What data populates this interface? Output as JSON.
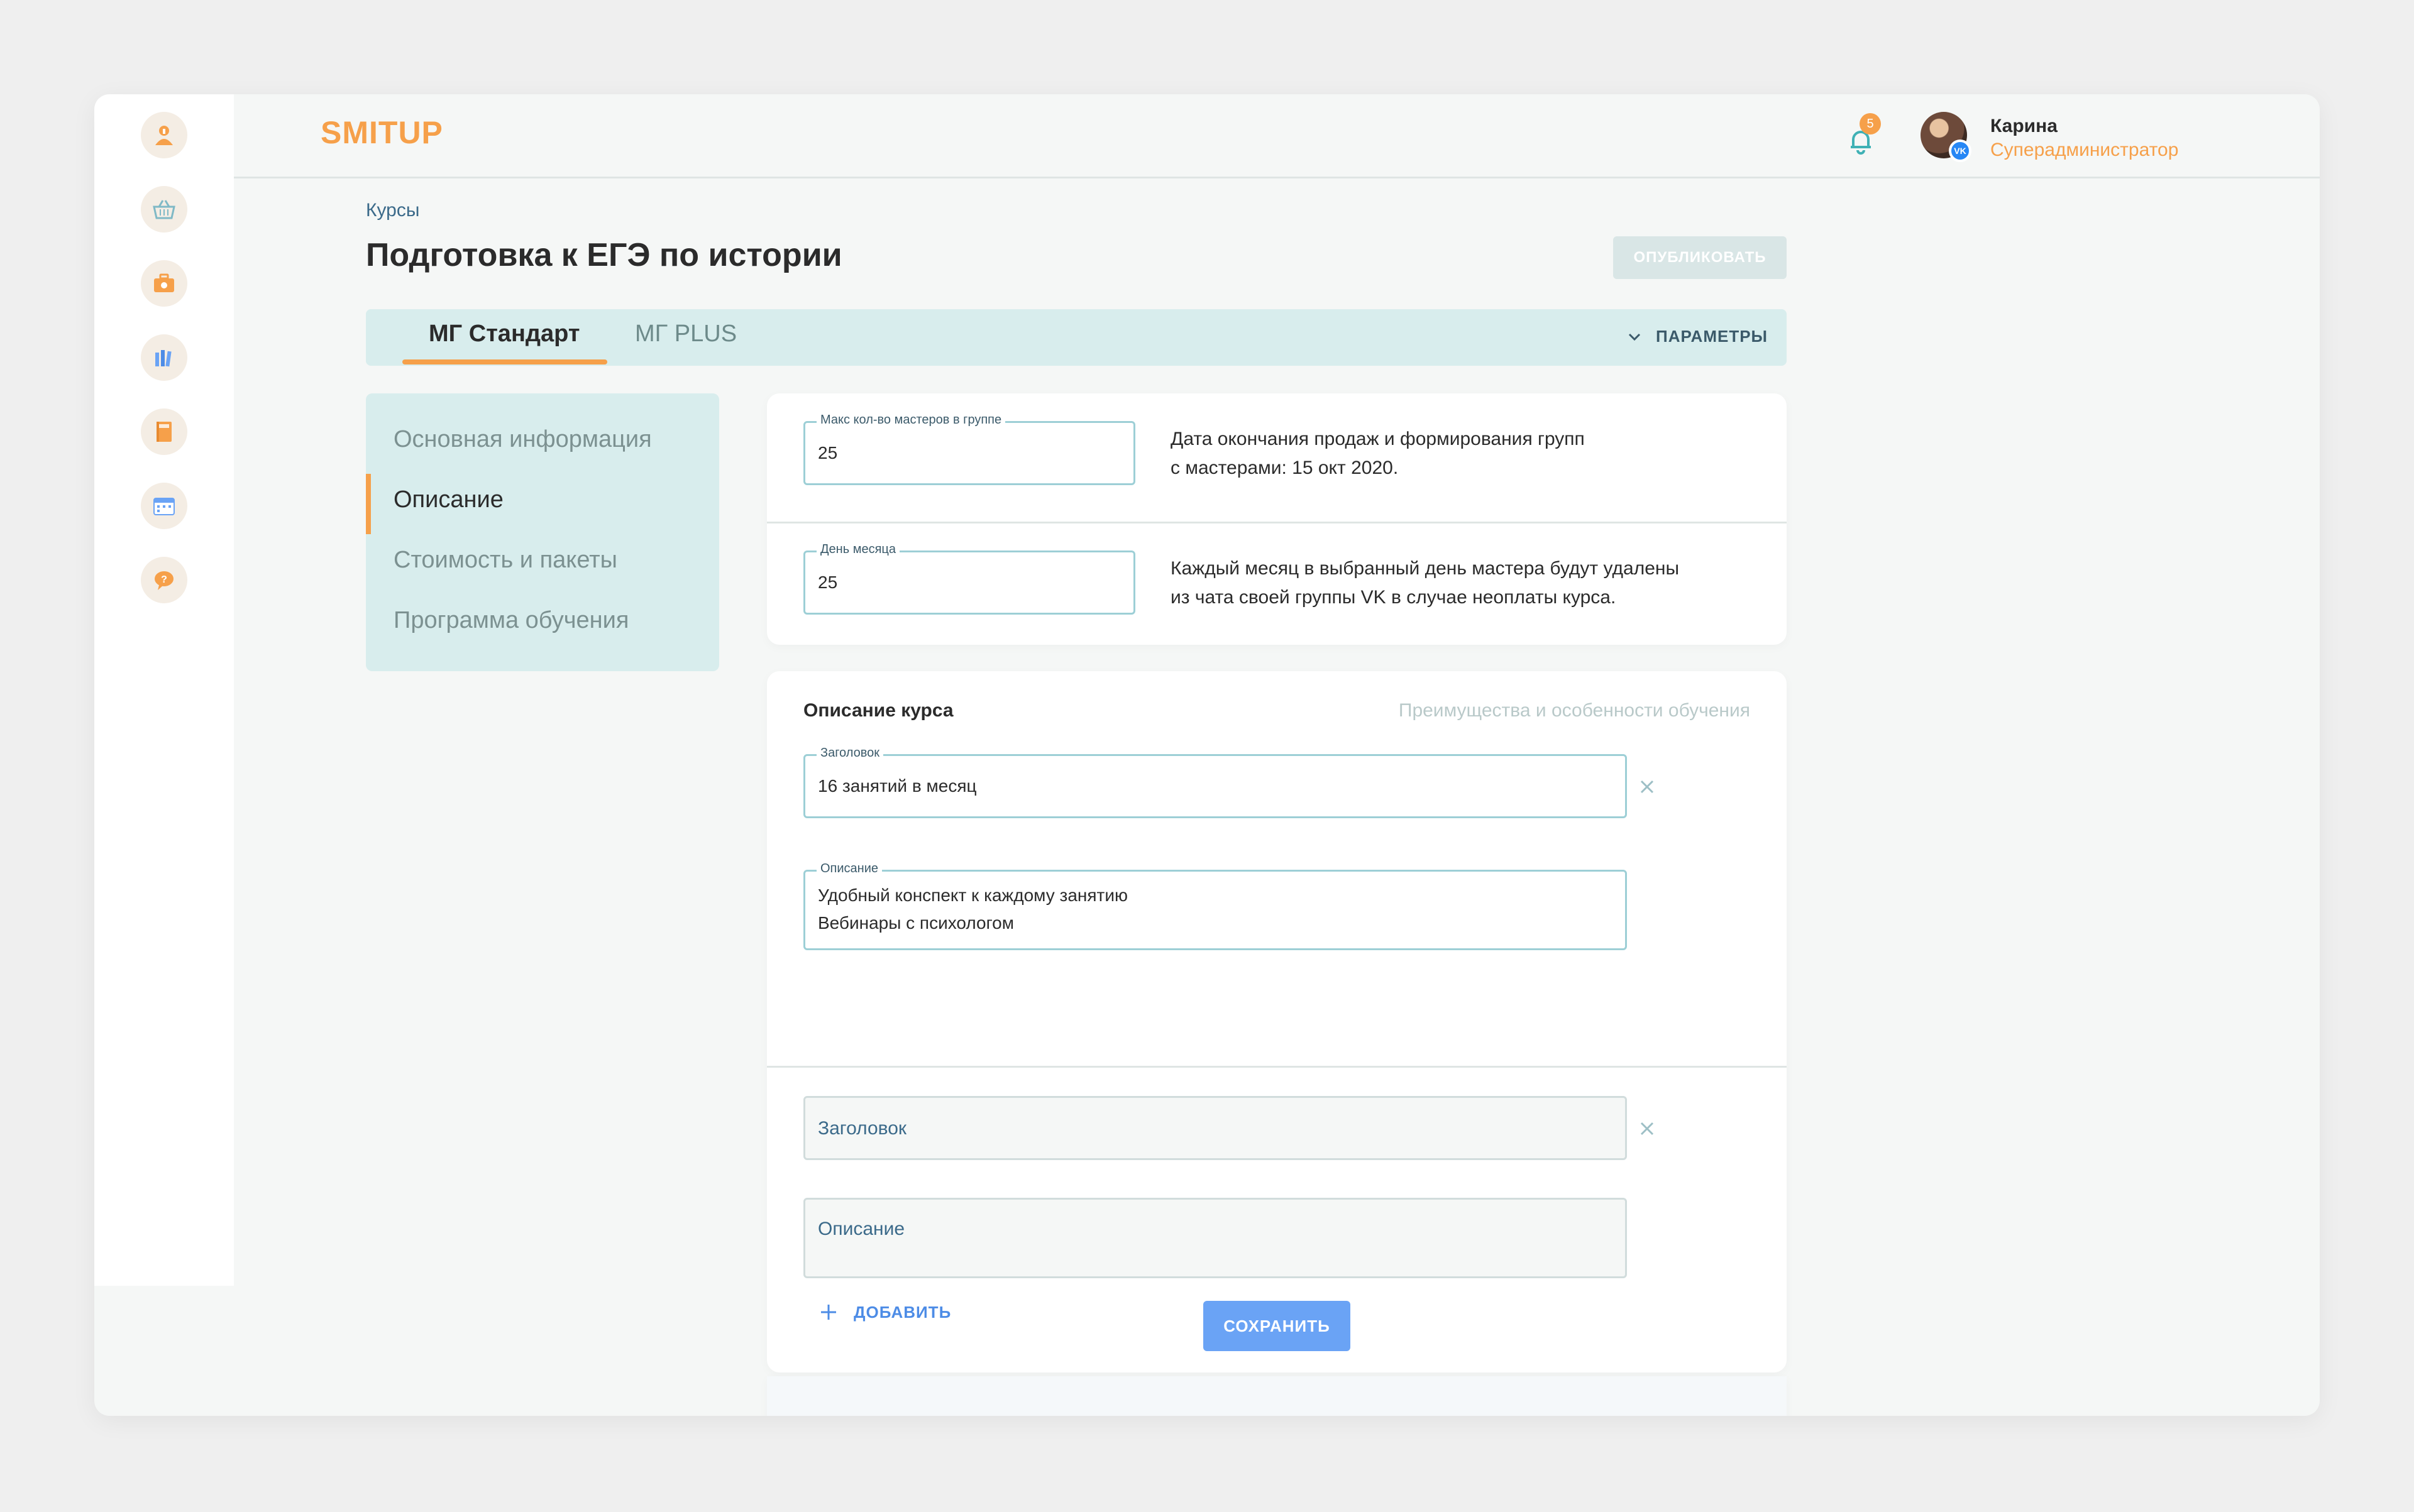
{
  "app": {
    "logo_text": "SMIT",
    "logo_up": "UP"
  },
  "header": {
    "notifications_count": "5",
    "user_name": "Карина",
    "user_role": "Суперадминистратор",
    "user_badge": "VK"
  },
  "sidebar": {
    "icons": [
      "profile-icon",
      "basket-icon",
      "briefcase-icon",
      "books-icon",
      "notebook-icon",
      "calendar-icon",
      "help-icon"
    ]
  },
  "page": {
    "breadcrumb": "Курсы",
    "title": "Подготовка к ЕГЭ по истории",
    "publish_label": "ОПУБЛИКОВАТЬ"
  },
  "tabs": {
    "items": [
      {
        "label": "МГ Стандарт",
        "active": true
      },
      {
        "label": "МГ PLUS",
        "active": false
      }
    ],
    "params_label": "ПАРАМЕТРЫ"
  },
  "leftnav": {
    "items": [
      {
        "label": "Основная информация"
      },
      {
        "label": "Описание"
      },
      {
        "label": "Стоимость и пакеты"
      },
      {
        "label": "Программа обучения"
      }
    ],
    "active_index": 1
  },
  "settings": {
    "max_masters": {
      "label": "Макс кол-во мастеров в группе",
      "value": "25",
      "hint_line1": "Дата окончания продаж и формирования групп",
      "hint_line2": "с мастерами: 15 окт 2020."
    },
    "day_of_month": {
      "label": "День месяца",
      "value": "25",
      "hint_line1": "Каждый месяц в выбранный день мастера будут удалены",
      "hint_line2": "из чата своей группы VK в случае неоплаты курса."
    }
  },
  "description": {
    "heading": "Описание курса",
    "subheading": "Преимущества и особенности обучения",
    "items": [
      {
        "title_label": "Заголовок",
        "title_value": "16 занятий в месяц",
        "desc_label": "Описание",
        "desc_line1": "Удобный конспект к каждому занятию",
        "desc_line2": "Вебинары с психологом"
      },
      {
        "title_placeholder": "Заголовок",
        "desc_placeholder": "Описание"
      }
    ],
    "add_label": "ДОБАВИТЬ",
    "save_label": "СОХРАНИТЬ"
  },
  "colors": {
    "accent": "#f6a04a",
    "panel": "#d8eded",
    "field_border": "#9dcfd6",
    "save_button": "#6aa3f5",
    "link": "#4d8ce6"
  }
}
